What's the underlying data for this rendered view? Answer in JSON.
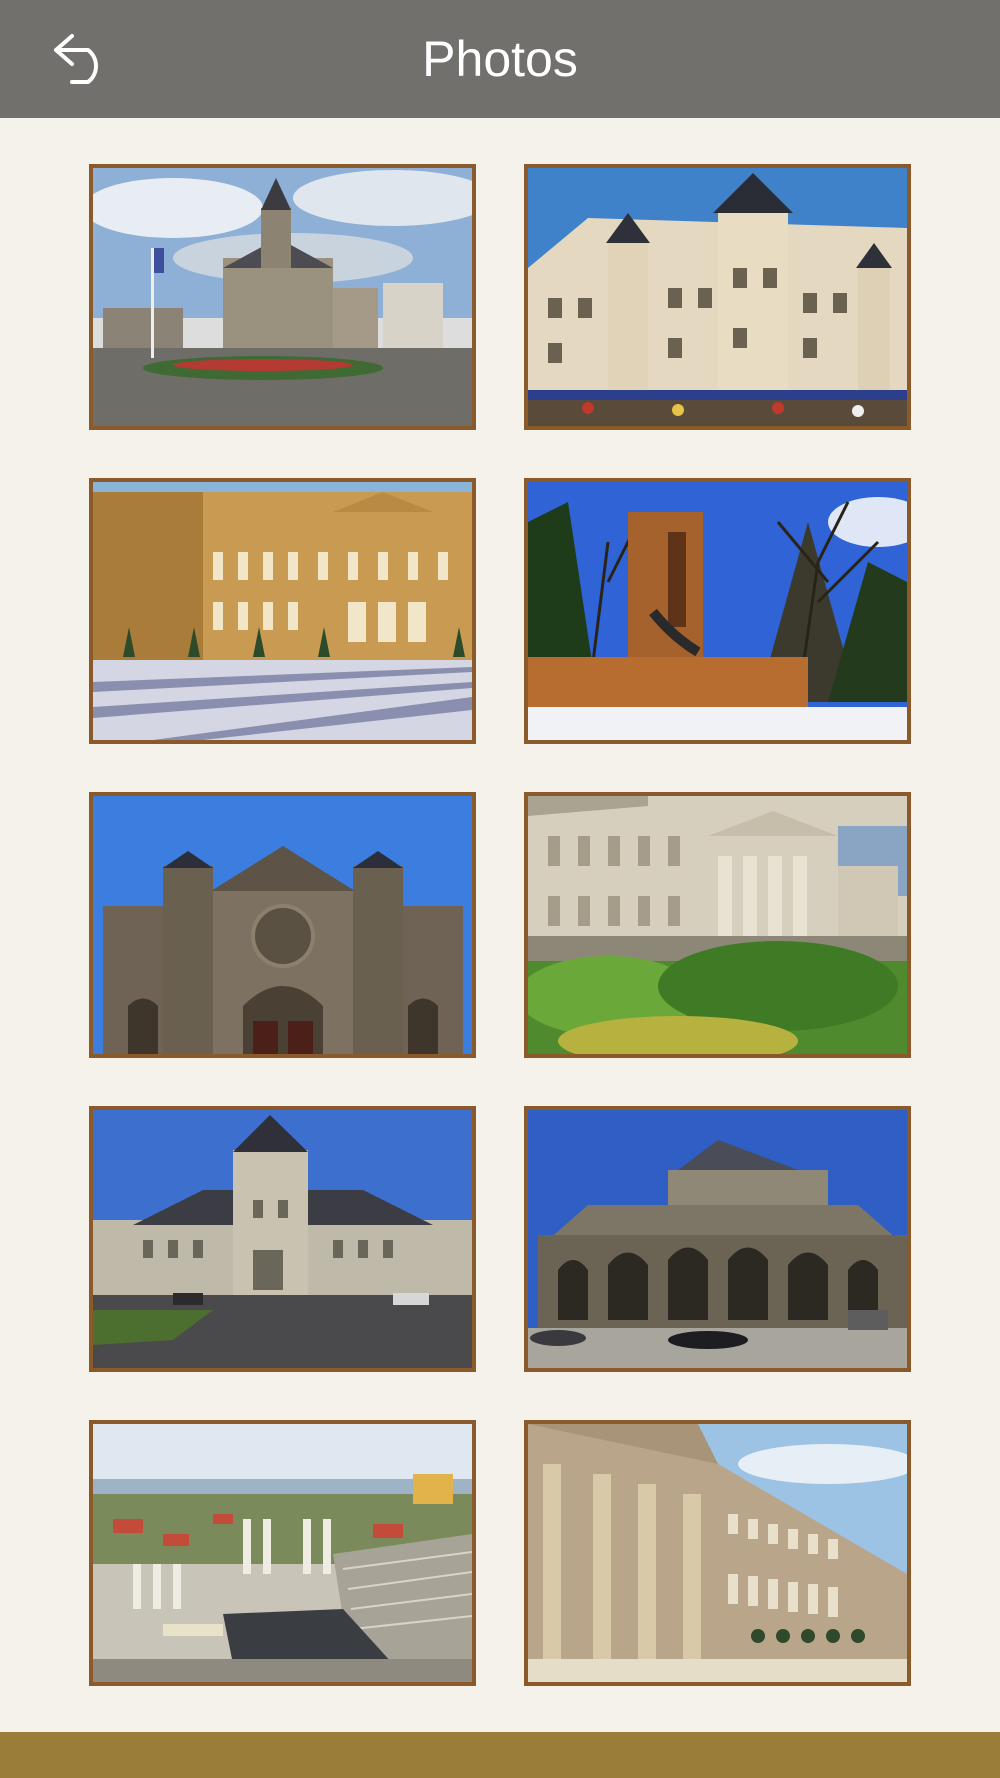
{
  "header": {
    "title": "Photos",
    "back_icon": "undo-arrow-icon",
    "background_color": "#72706c"
  },
  "photos": [
    {
      "subject": "town-hall-square"
    },
    {
      "subject": "ornate-palace-facade"
    },
    {
      "subject": "classical-palace-courtyard"
    },
    {
      "subject": "stone-monument"
    },
    {
      "subject": "gothic-church-facade"
    },
    {
      "subject": "neoclassical-building"
    },
    {
      "subject": "town-hall-blue-sky"
    },
    {
      "subject": "cathedral-apse"
    },
    {
      "subject": "roman-theatre"
    },
    {
      "subject": "colonnade-palace"
    }
  ],
  "colors": {
    "page_background": "#f5f2ec",
    "photo_border": "#8b5a2b",
    "footer_bar": "#9b7d3a"
  }
}
